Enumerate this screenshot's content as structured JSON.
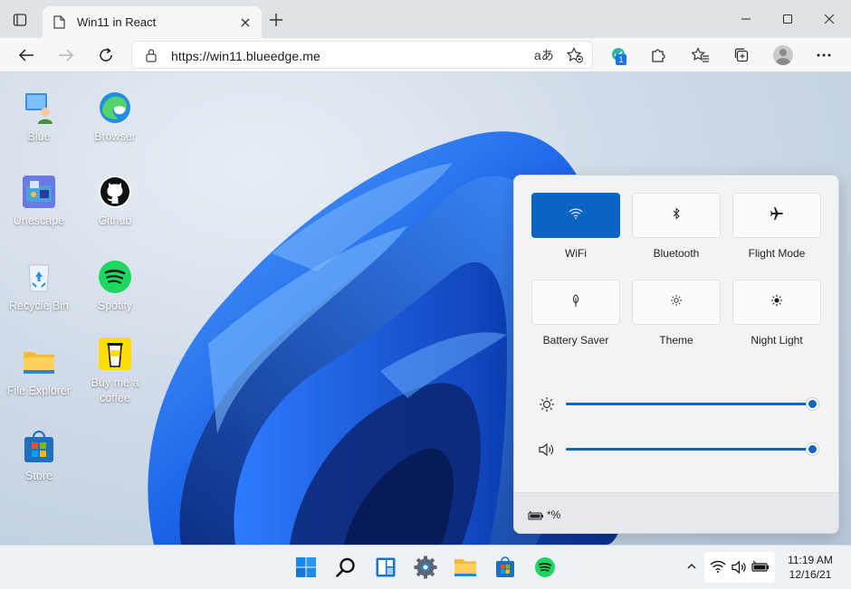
{
  "browser": {
    "tab_title": "Win11 in React",
    "url": "https://win11.blueedge.me",
    "read_aloud": "aあ",
    "extension_badge": "1"
  },
  "desktop": {
    "icons": [
      {
        "label": "Blue"
      },
      {
        "label": "Browser"
      },
      {
        "label": "Unescape"
      },
      {
        "label": "Github"
      },
      {
        "label": "Recycle Bin"
      },
      {
        "label": "Spotify"
      },
      {
        "label": "File Explorer"
      },
      {
        "label": "Buy me a coffee"
      },
      {
        "label": "Store"
      }
    ]
  },
  "action_center": {
    "tiles": [
      {
        "label": "WiFi",
        "active": true
      },
      {
        "label": "Bluetooth",
        "active": false
      },
      {
        "label": "Flight Mode",
        "active": false
      },
      {
        "label": "Battery Saver",
        "active": false
      },
      {
        "label": "Theme",
        "active": false
      },
      {
        "label": "Night Light",
        "active": false
      }
    ],
    "brightness": 1.0,
    "volume": 1.0,
    "battery_text": "*%"
  },
  "taskbar": {
    "time": "11:19 AM",
    "date": "12/16/21"
  },
  "colors": {
    "accent": "#0b63c4",
    "tabstrip": "#dfe3e8",
    "taskbar": "#eef1f5"
  }
}
